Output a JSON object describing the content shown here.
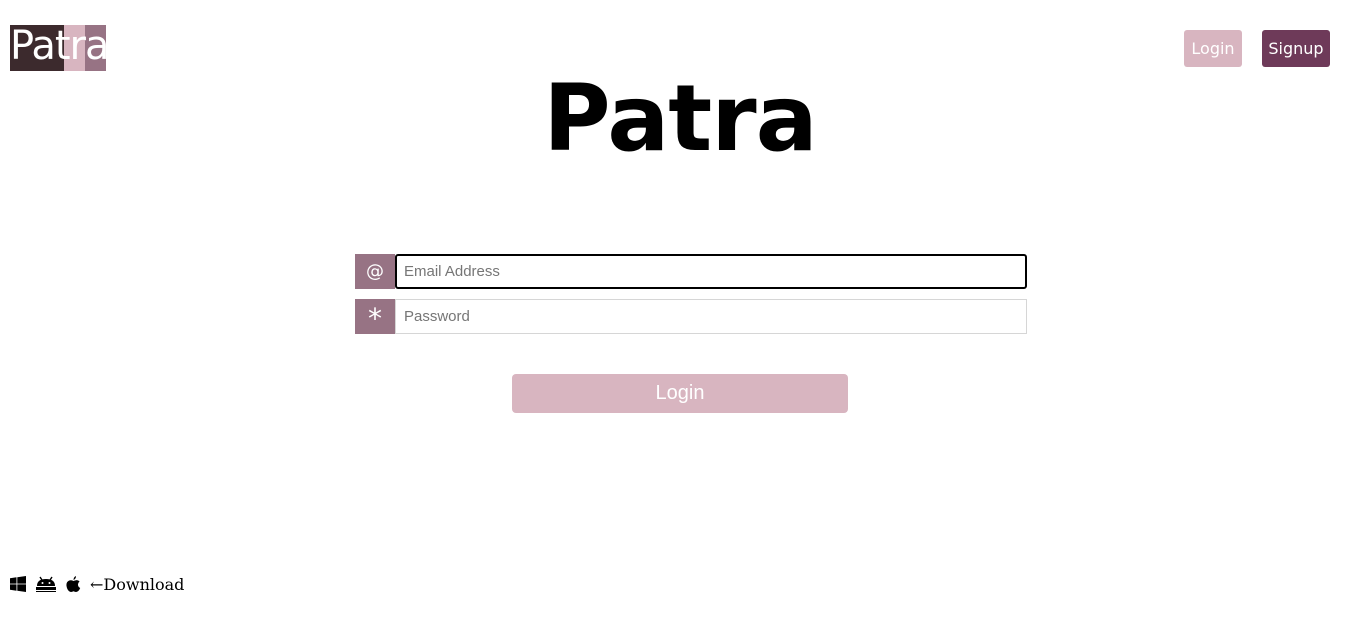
{
  "colors": {
    "brand_dark": "#3c2a2d",
    "brand_light": "#d8b5c0",
    "brand_mid": "#977384",
    "signup_bg": "#6e3a59",
    "addon_bg": "#977384",
    "login_bg": "#d8b5c0"
  },
  "header": {
    "logo_text": "Patra",
    "nav": {
      "login_label": "Login",
      "signup_label": "Signup"
    }
  },
  "main": {
    "title": "Patra",
    "email": {
      "icon": "at-icon",
      "icon_glyph": "@",
      "placeholder": "Email Address",
      "value": ""
    },
    "password": {
      "icon": "asterisk-icon",
      "icon_glyph": "*",
      "placeholder": "Password",
      "value": ""
    },
    "login_button_label": "Login"
  },
  "footer": {
    "icons": [
      "windows-icon",
      "android-icon",
      "apple-icon"
    ],
    "download_text": "←Download"
  }
}
